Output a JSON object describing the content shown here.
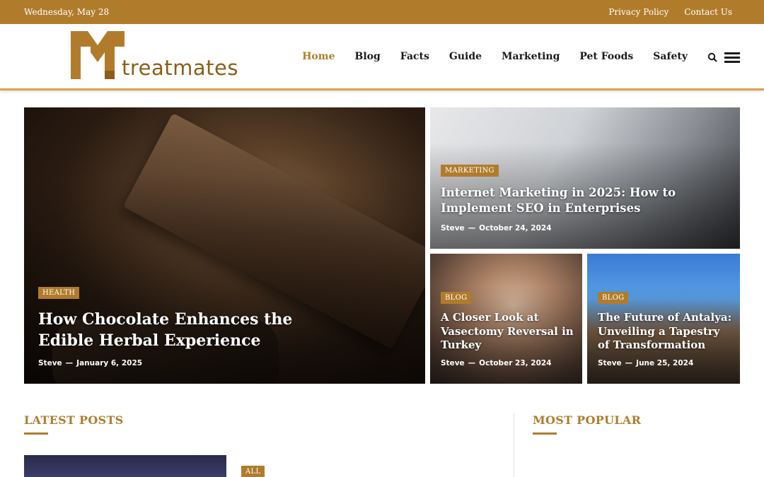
{
  "topbar": {
    "date": "Wednesday, May 28",
    "links": [
      "Privacy Policy",
      "Contact Us"
    ]
  },
  "header": {
    "logo_text": "treatmates",
    "nav": [
      "Home",
      "Blog",
      "Facts",
      "Guide",
      "Marketing",
      "Pet Foods",
      "Safety"
    ],
    "active_nav": "Home"
  },
  "hero": {
    "main": {
      "category": "HEALTH",
      "title": "How Chocolate Enhances the Edible Herbal Experience",
      "author": "Steve",
      "date": "January 6, 2025"
    },
    "marketing": {
      "category": "MARKETING",
      "title": "Internet Marketing in 2025: How to Implement SEO in Enterprises",
      "author": "Steve",
      "date": "October 24, 2024"
    },
    "turkey": {
      "category": "BLOG",
      "title": "A Closer Look at Vasectomy Reversal in Turkey",
      "author": "Steve",
      "date": "October 23, 2024"
    },
    "antalya": {
      "category": "BLOG",
      "title": "The Future of Antalya: Unveiling a Tapestry of Transformation",
      "author": "Steve",
      "date": "June 25, 2024"
    }
  },
  "sections": {
    "latest": "LATEST POSTS",
    "popular": "MOST POPULAR",
    "latest_first_category": "ALL"
  },
  "colors": {
    "accent": "#b07c2c",
    "logo": "#8b5e1a"
  }
}
